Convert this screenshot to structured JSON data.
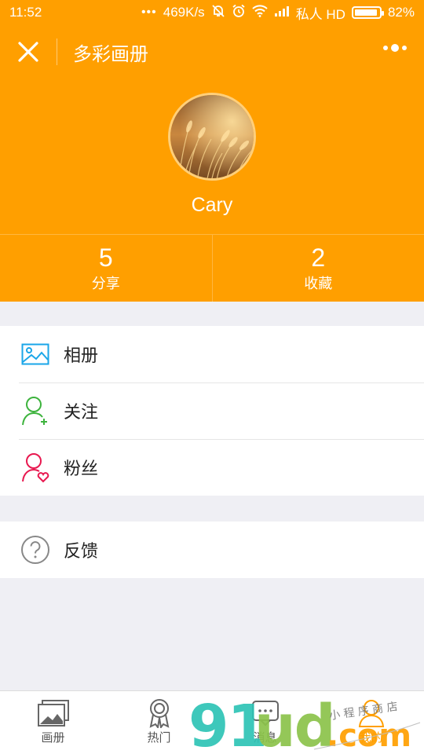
{
  "status_bar": {
    "time": "11:52",
    "network_speed": "469K/s",
    "carrier": "私人 HD",
    "battery": "82%"
  },
  "navbar": {
    "title": "多彩画册",
    "close_icon": "close-icon",
    "more_icon": "more-dots-icon"
  },
  "profile": {
    "username": "Cary"
  },
  "stats": [
    {
      "value": "5",
      "label": "分享"
    },
    {
      "value": "2",
      "label": "收藏"
    }
  ],
  "menu_group_1": [
    {
      "label": "相册",
      "icon": "album-icon",
      "color": "#1aa6e8"
    },
    {
      "label": "关注",
      "icon": "follow-user-icon",
      "color": "#3db33d"
    },
    {
      "label": "粉丝",
      "icon": "fans-heart-icon",
      "color": "#e8184f"
    }
  ],
  "menu_group_2": [
    {
      "label": "反馈",
      "icon": "question-icon",
      "color": "#888888"
    }
  ],
  "tabbar": [
    {
      "label": "画册",
      "icon": "gallery-icon"
    },
    {
      "label": "热门",
      "icon": "award-icon"
    },
    {
      "label": "消息",
      "icon": "message-icon"
    },
    {
      "label": "我的",
      "icon": "user-icon",
      "active": true
    }
  ],
  "watermark": {
    "logo": "91ud",
    "domain": ".com",
    "tagline": "小程序商店"
  },
  "colors": {
    "brand": "#ff9f00",
    "background": "#efeff4"
  }
}
